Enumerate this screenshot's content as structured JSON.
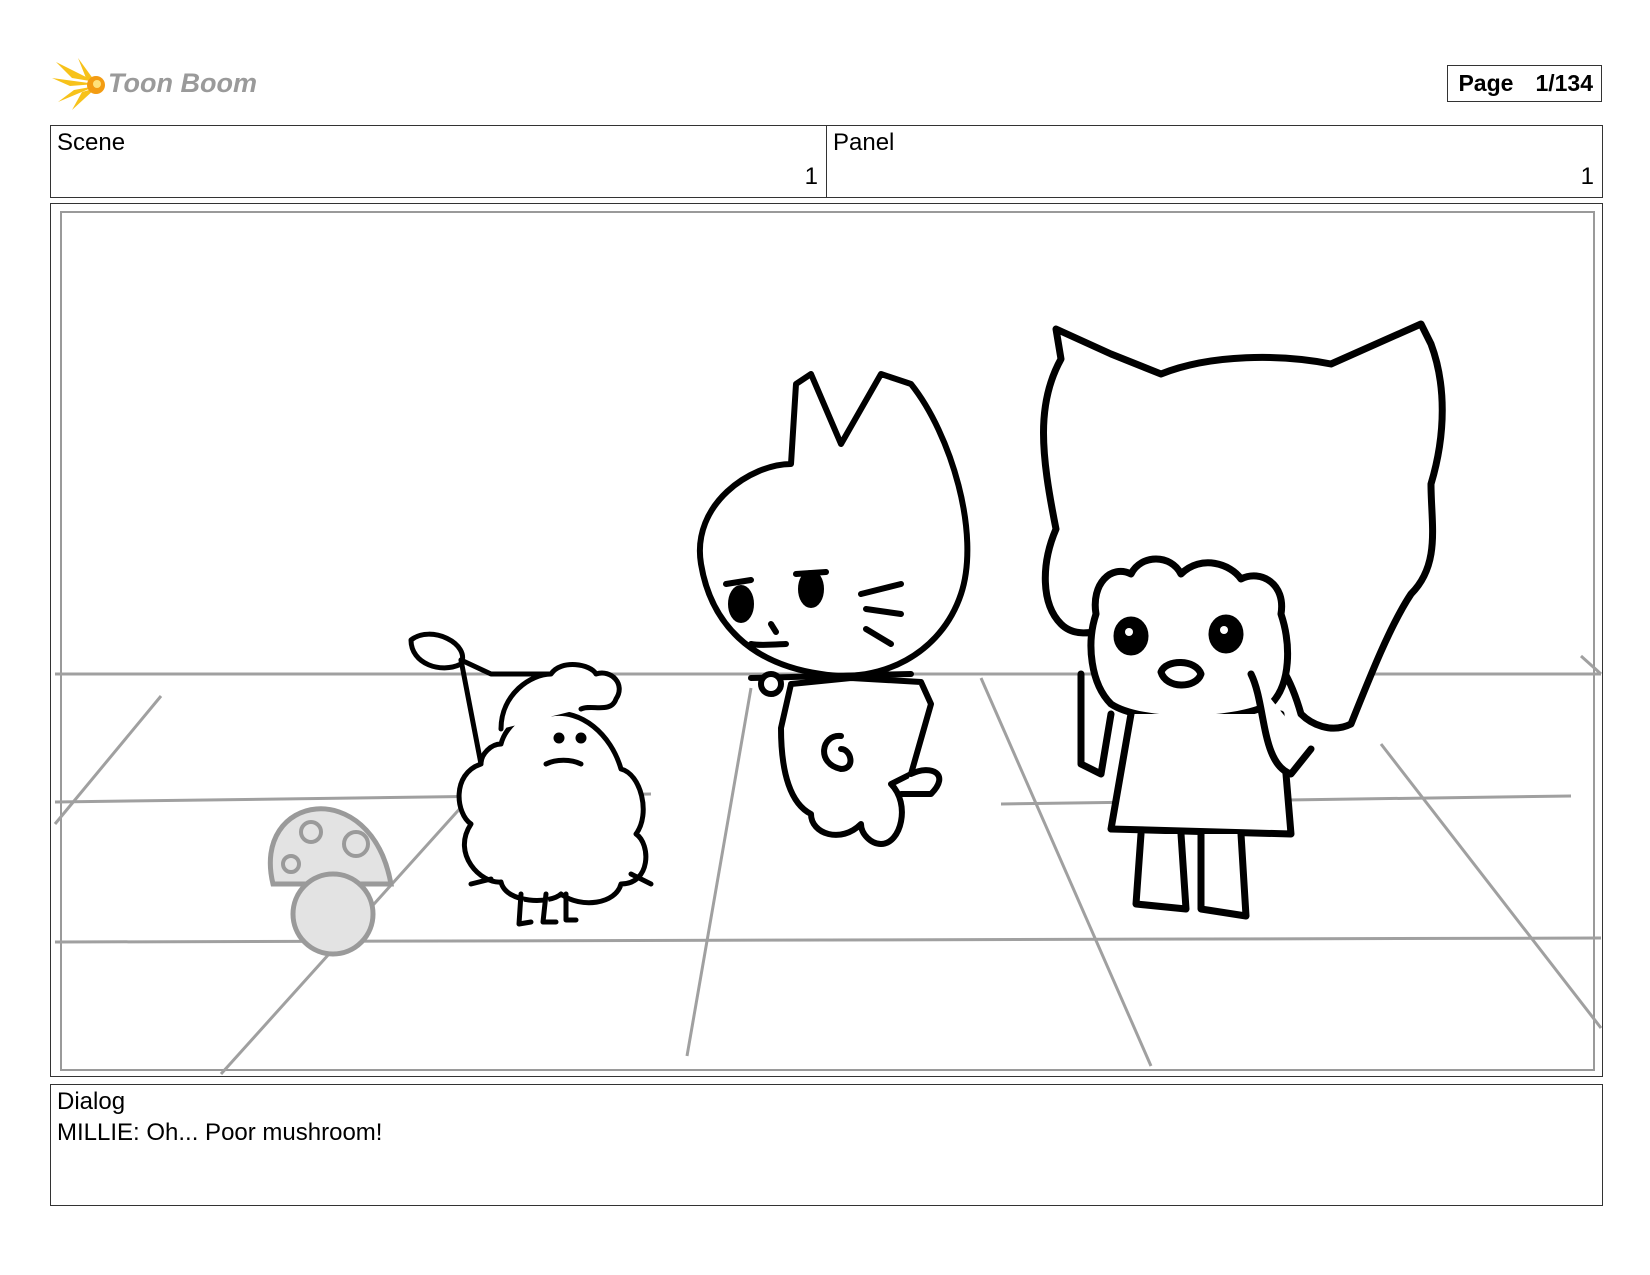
{
  "brand": {
    "logo_text": "Toon Boom",
    "accent": "#f7c21a"
  },
  "page": {
    "label": "Page",
    "number": "1/134"
  },
  "scene": {
    "label": "Scene",
    "value": "1"
  },
  "panel": {
    "label": "Panel",
    "value": "1"
  },
  "dialog": {
    "label": "Dialog",
    "text": "MILLIE: Oh... Poor mushroom!"
  }
}
